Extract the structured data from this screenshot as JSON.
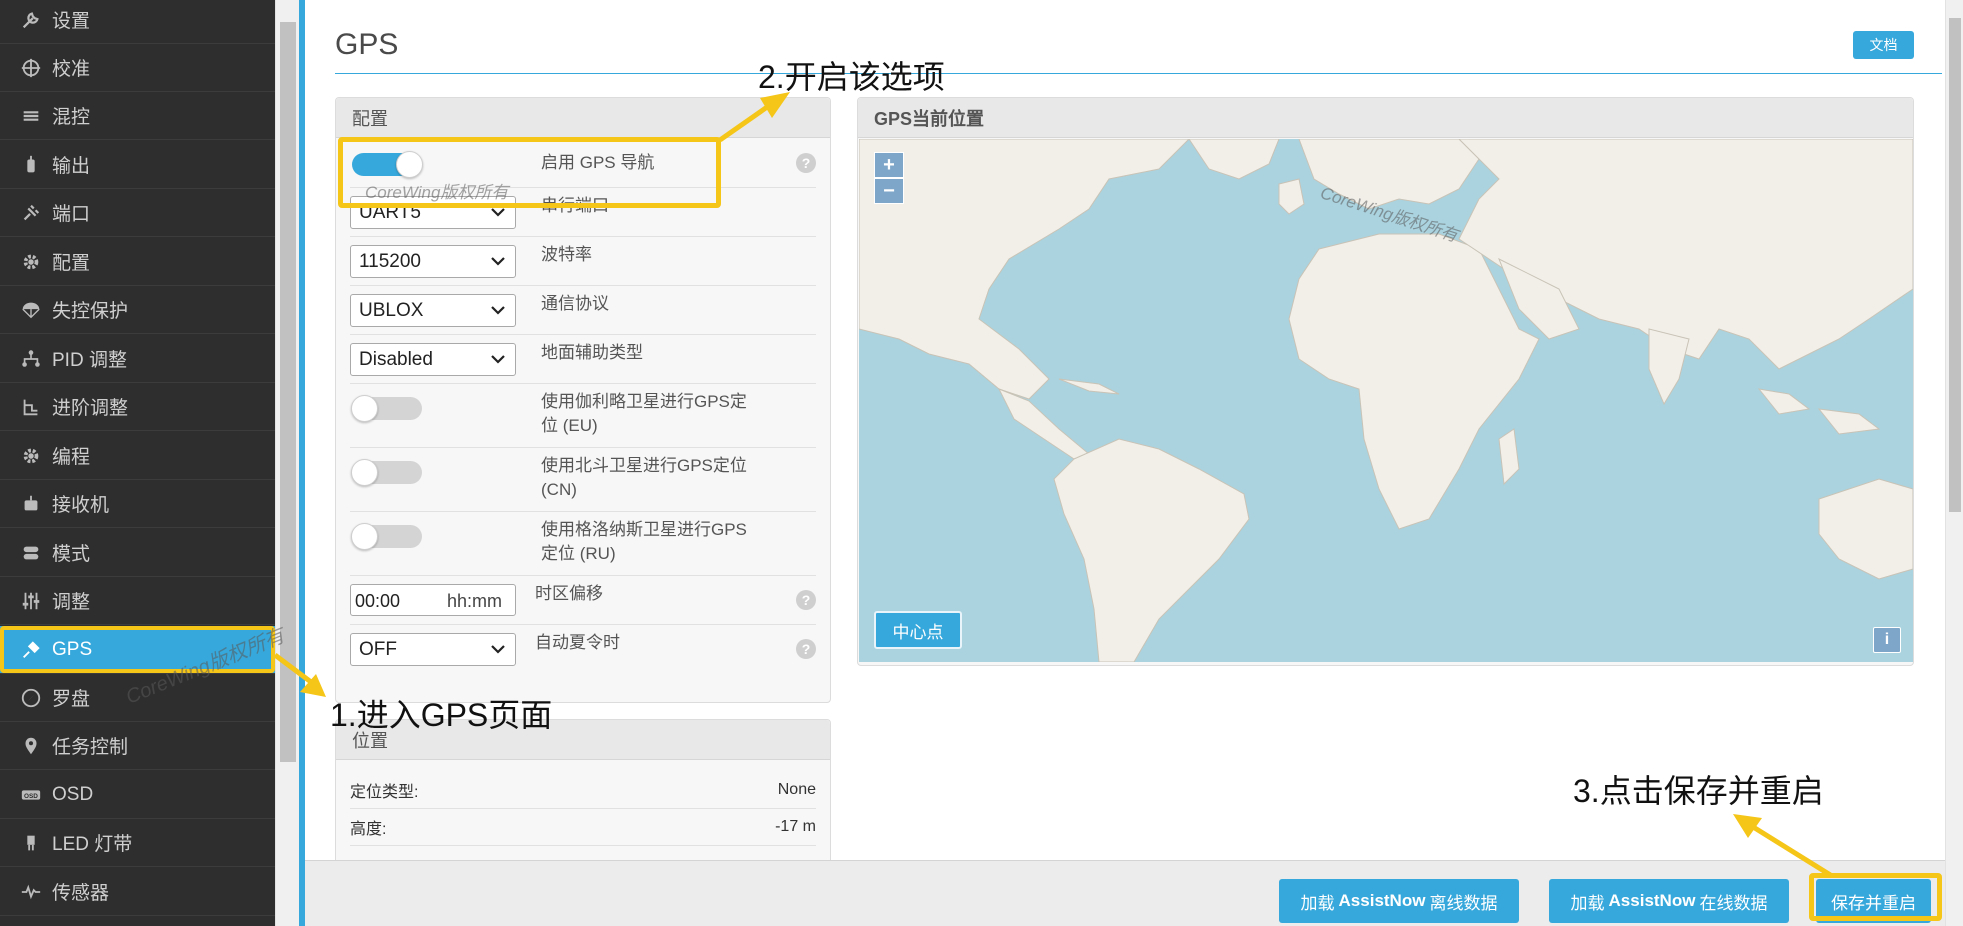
{
  "sidebar": {
    "items": [
      {
        "label": "设置",
        "icon": "wrench-icon"
      },
      {
        "label": "校准",
        "icon": "crosshair-icon"
      },
      {
        "label": "混控",
        "icon": "mixer-icon"
      },
      {
        "label": "输出",
        "icon": "motor-icon"
      },
      {
        "label": "端口",
        "icon": "plug-icon"
      },
      {
        "label": "配置",
        "icon": "gear-icon"
      },
      {
        "label": "失控保护",
        "icon": "parachute-icon"
      },
      {
        "label": "PID 调整",
        "icon": "pid-icon"
      },
      {
        "label": "进阶调整",
        "icon": "advanced-tuning-icon"
      },
      {
        "label": "编程",
        "icon": "cog-icon"
      },
      {
        "label": "接收机",
        "icon": "receiver-icon"
      },
      {
        "label": "模式",
        "icon": "switch-icon"
      },
      {
        "label": "调整",
        "icon": "sliders-icon"
      },
      {
        "label": "GPS",
        "icon": "satellite-icon"
      },
      {
        "label": "罗盘",
        "icon": "compass-icon"
      },
      {
        "label": "任务控制",
        "icon": "map-pin-icon"
      },
      {
        "label": "OSD",
        "icon": "osd-icon"
      },
      {
        "label": "LED 灯带",
        "icon": "led-icon"
      },
      {
        "label": "传感器",
        "icon": "pulse-icon"
      }
    ],
    "active": "GPS"
  },
  "page": {
    "title": "GPS",
    "doc_button": "文档"
  },
  "config": {
    "header": "配置",
    "gps_nav": {
      "label": "启用 GPS 导航",
      "enabled": true
    },
    "serial_port": {
      "label": "串行端口",
      "value": "UART5"
    },
    "baud": {
      "label": "波特率",
      "value": "115200"
    },
    "protocol": {
      "label": "通信协议",
      "value": "UBLOX"
    },
    "ground_assist": {
      "label": "地面辅助类型",
      "value": "Disabled"
    },
    "galileo": {
      "label_line1": "使用伽利略卫星进行GPS定",
      "label_line2": "位 (EU)",
      "enabled": false
    },
    "beidou": {
      "label_line1": "使用北斗卫星进行GPS定位",
      "label_line2": "(CN)",
      "enabled": false
    },
    "glonass": {
      "label_line1": "使用格洛纳斯卫星进行GPS",
      "label_line2": "定位 (RU)",
      "enabled": false
    },
    "timezone": {
      "label": "时区偏移",
      "value": "00:00",
      "unit": "hh:mm"
    },
    "dst": {
      "label": "自动夏令时",
      "value": "OFF"
    },
    "help_glyph": "?"
  },
  "position": {
    "header": "位置",
    "rows": [
      {
        "label": "定位类型:",
        "value": "None"
      },
      {
        "label": "高度:",
        "value": "-17 m"
      }
    ]
  },
  "map_panel": {
    "header": "GPS当前位置",
    "zoom_in": "+",
    "zoom_out": "−",
    "center_button": "中心点",
    "info_button": "i"
  },
  "footer": {
    "offline_btn": {
      "prefix": "加载",
      "bold": "AssistNow",
      "suffix": "离线数据"
    },
    "online_btn": {
      "prefix": "加载",
      "bold": "AssistNow",
      "suffix": "在线数据"
    },
    "save_btn": "保存并重启"
  },
  "annotations": {
    "step1": "1.进入GPS页面",
    "step2": "2.开启该选项",
    "step3": "3.点击保存并重启",
    "watermark": "CoreWing版权所有"
  },
  "colors": {
    "accent": "#37a8db",
    "highlight": "#f5c518",
    "sidebar_bg": "#2e2e2e",
    "map_water": "#aad3df",
    "map_land": "#f2efe9"
  }
}
